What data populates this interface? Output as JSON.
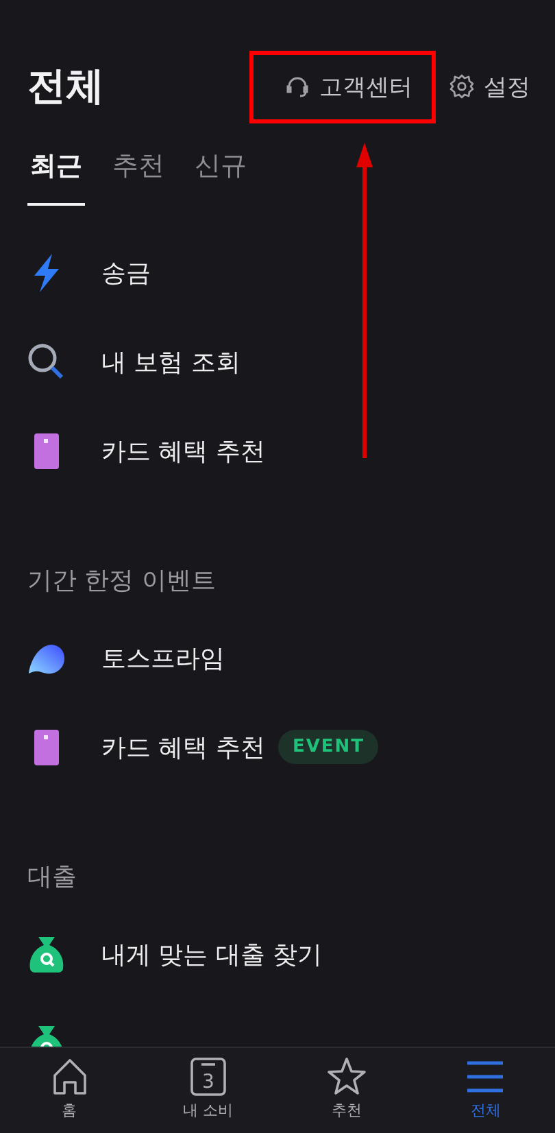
{
  "header": {
    "title": "전체",
    "actions": [
      {
        "kind": "support",
        "label": "고객센터",
        "highlighted": true
      },
      {
        "kind": "settings",
        "label": "설정",
        "highlighted": false
      }
    ]
  },
  "tabs": [
    {
      "label": "최근",
      "selected": true
    },
    {
      "label": "추천",
      "selected": false
    },
    {
      "label": "신규",
      "selected": false
    }
  ],
  "sections": [
    {
      "items": [
        {
          "kind": "bolt",
          "label": "송금"
        },
        {
          "kind": "search",
          "label": "내 보험 조회"
        },
        {
          "kind": "card",
          "label": "카드 혜택 추천"
        }
      ]
    },
    {
      "title": "기간 한정 이벤트",
      "items": [
        {
          "kind": "blob",
          "label": "토스프라임"
        },
        {
          "kind": "card",
          "label": "카드 혜택 추천",
          "badge": "EVENT"
        }
      ]
    },
    {
      "title": "대출",
      "items": [
        {
          "kind": "moneybag",
          "label": "내게 맞는 대출 찾기"
        },
        {
          "kind": "moneybag"
        }
      ]
    }
  ],
  "nav": [
    {
      "kind": "home",
      "label": "홈",
      "selected": false
    },
    {
      "kind": "calendar",
      "label": "내 소비",
      "digit": "3",
      "selected": false
    },
    {
      "kind": "star",
      "label": "추천",
      "selected": false
    },
    {
      "kind": "menu",
      "label": "전체",
      "selected": true
    }
  ]
}
